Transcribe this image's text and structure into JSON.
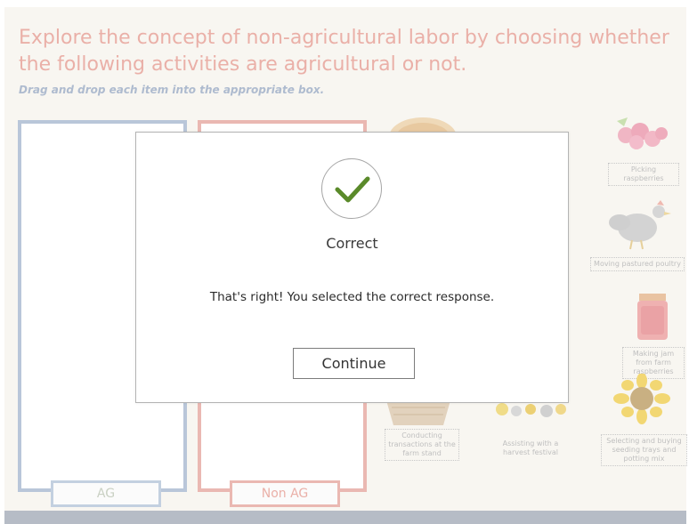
{
  "activity": {
    "title": "Explore the concept of non-agricultural labor by choosing whether the following activities are agricultural or not.",
    "instruction": "Drag and drop each item into the appropriate box."
  },
  "drop_targets": {
    "ag_label": "AG",
    "nonag_label": "Non AG"
  },
  "items": {
    "picking_raspberries": "Picking raspberries",
    "moving_poultry": "Moving pastured poultry",
    "making_jam": "Making jam from farm raspberries",
    "conducting_transactions": "Conducting transactions at the farm stand",
    "harvest_festival": "Assisting with a harvest festival",
    "seeding_trays": "Selecting and buying seeding trays and potting mix"
  },
  "dialog": {
    "icon": "checkmark-icon",
    "title": "Correct",
    "message": "That's right! You selected the correct response.",
    "continue_label": "Continue"
  },
  "colors": {
    "title": "#eab0a8",
    "instruction": "#aebbcf",
    "ag_border": "#b9c6d9",
    "nonag_border": "#eab8b2",
    "check": "#5a8a2a"
  }
}
